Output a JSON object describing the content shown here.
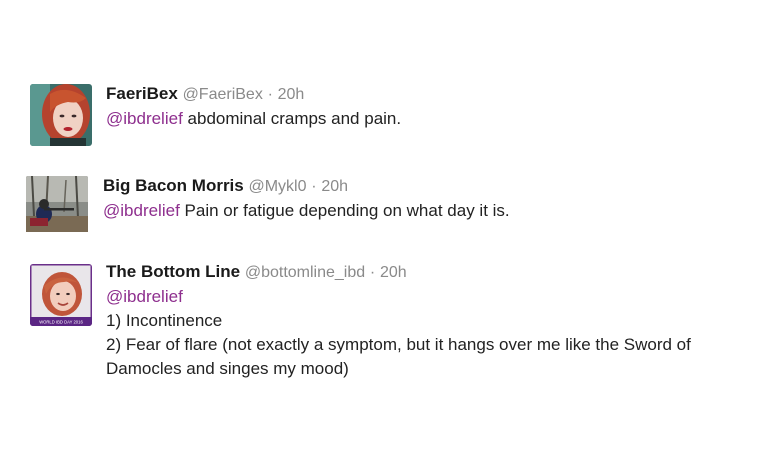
{
  "tweets": [
    {
      "display_name": "FaeriBex",
      "handle": "@FaeriBex",
      "separator": "·",
      "time": "20h",
      "mention": "@ibdrelief",
      "text": "abdominal cramps and pain.",
      "avatar_icon": "avatar-red-haired-woman"
    },
    {
      "display_name": "Big Bacon Morris",
      "handle": "@Mykl0",
      "separator": "·",
      "time": "20h",
      "mention": "@ibdrelief",
      "text": "Pain or fatigue depending on what day it is.",
      "avatar_icon": "avatar-person-with-rifle-outdoors"
    },
    {
      "display_name": "The Bottom Line",
      "handle": "@bottomline_ibd",
      "separator": "·",
      "time": "20h",
      "mention": "@ibdrelief",
      "lines": [
        "1) Incontinence",
        "2) Fear of flare (not exactly a symptom, but it hangs over me like the Sword of",
        "Damocles and singes my mood)"
      ],
      "avatar_icon": "avatar-woman-with-purple-banner",
      "avatar_banner_text": "WORLD IBD DAY 2016"
    }
  ],
  "colors": {
    "mention": "#8e2f8e",
    "meta": "#8a8a8a",
    "name": "#1a1a1a"
  }
}
